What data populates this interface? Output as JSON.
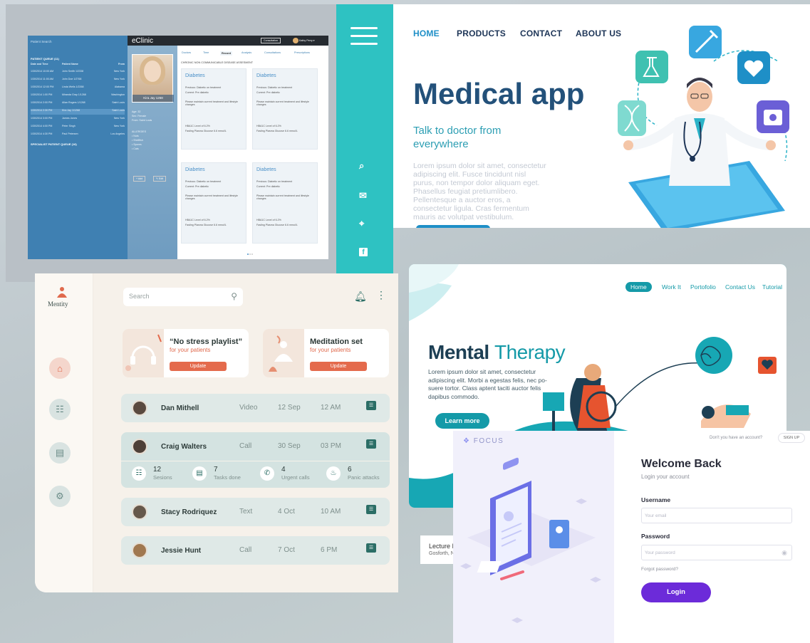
{
  "eclinic": {
    "logo": "eClinic",
    "search": "Patient Search",
    "consultation_btn": "Consultation",
    "user_menu": "Kathy Perry ▾",
    "list_section": "PATIENT QUEUE (11)",
    "list_section2": "SPECIALIST PATIENT QUEUE (16)",
    "list_headers": [
      "Date and Time",
      "Patient Name",
      "From"
    ],
    "rows": [
      [
        "1/30/2014 10:00 AM",
        "John Smith 1/2338",
        "New York"
      ],
      [
        "1/30/2014 11:00 AM",
        "John Doe 1/2768",
        "New York"
      ],
      [
        "1/30/2014 12:00 PM",
        "Linda Wells 1/2268",
        "Alabama"
      ],
      [
        "1/30/2014 1:00 PM",
        "Miranda Gray 1/1268",
        "Washington"
      ],
      [
        "1/30/2014 2:00 PM",
        "Allan Rogers 1/1268",
        "Saint Louis"
      ],
      [
        "1/30/2014 2:30 PM",
        "Kira Jay 1/1268",
        "Saint Louis"
      ],
      [
        "1/30/2014 3:00 PM",
        "James Jones",
        "New York"
      ],
      [
        "1/30/2014 4:00 PM",
        "Peter Singh",
        "New York"
      ],
      [
        "1/30/2014 4:30 PM",
        "Paul Petersen",
        "Los Angeles"
      ]
    ],
    "patient_name": "Kira Jay 1268",
    "patient_info": [
      "Age: 32",
      "Sex: Female",
      "From: Saint Louis"
    ],
    "allergies_title": "ALLERGIES",
    "allergies": [
      "• Nuts",
      "• Shellfish",
      "• Spores",
      "• Cats"
    ],
    "add_btn": "+ Add",
    "edit_btn": "✎ Edit",
    "tabs": [
      "Doctors",
      "Time",
      "Record",
      "Analysis",
      "Consultations",
      "Prescriptions"
    ],
    "active_tab": "Record",
    "assessment_title": "CHRONIC NON COMMUNICABLE DISEASE ASSESMENT",
    "cards": [
      {
        "title": "Diabetes",
        "prev": "Previous: Diabetic on treatment",
        "curr": "Current: Pre diabetic",
        "note": "Please maintain current treatment and lifestyle changes",
        "hba": "HBA1C Level of 6.2%",
        "glu": "Fasting Plasma Glucose 6.6 mmol/L"
      },
      {
        "title": "Diabetes",
        "prev": "Previous: Diabetic on treatment",
        "curr": "Current: Pre diabetic",
        "note": "Please maintain current treatment and lifestyle changes",
        "hba": "HBA1C Level of 6.2%",
        "glu": "Fasting Plasma Glucose 6.6 mmol/L"
      },
      {
        "title": "Diabetes",
        "prev": "Previous: Diabetic on treatment",
        "curr": "Current: Pre diabetic",
        "note": "Please maintain current treatment and lifestyle changes",
        "hba": "HBA1C Level of 6.2%",
        "glu": "Fasting Plasma Glucose 6.6 mmol/L"
      },
      {
        "title": "Diabetes",
        "prev": "Previous: Diabetic on treatment",
        "curr": "Current: Pre diabetic",
        "note": "Please maintain current treatment and lifestyle changes",
        "hba": "HBA1C Level of 6.2%",
        "glu": "Fasting Plasma Glucose 6.6 mmol/L"
      }
    ]
  },
  "sidebar_icons": [
    "search-icon",
    "mail-icon",
    "location-icon",
    "facebook-icon"
  ],
  "sidebar_glyphs": {
    "search": "⌕",
    "mail": "✉",
    "location": "⌖",
    "facebook": "f"
  },
  "medical": {
    "nav": [
      "HOME",
      "PRODUCTS",
      "CONTACT",
      "ABOUT US"
    ],
    "title": "Medical app",
    "subtitle": "Talk to doctor from everywhere",
    "lorem": "Lorem ipsum dolor sit amet, consectetur adipiscing elit. Fusce tincidunt nisl purus, non tempor dolor aliquam eget. Phasellus feugiat pretiumlibero. Pellentesque a auctor eros, a consectetur ligula. Cras fermentum mauris ac volutpat vestibulum."
  },
  "mentity": {
    "brand": "Mentity",
    "search_placeholder": "Search",
    "promos": [
      {
        "title": "“No stress playlist”",
        "sub": "for your patients",
        "btn": "Update"
      },
      {
        "title": "Meditation set",
        "sub": "for your patients",
        "btn": "Update"
      }
    ],
    "patients": [
      {
        "name": "Dan Mithell",
        "type": "Video",
        "date": "12 Sep",
        "time": "12 AM"
      },
      {
        "name": "Craig Walters",
        "type": "Call",
        "date": "30 Sep",
        "time": "03 PM"
      },
      {
        "name": "Stacy Rodriquez",
        "type": "Text",
        "date": "4 Oct",
        "time": "10 AM"
      },
      {
        "name": "Jessie Hunt",
        "type": "Call",
        "date": "7 Oct",
        "time": "6 PM"
      }
    ],
    "stats": [
      {
        "value": "12",
        "label": "Sesions"
      },
      {
        "value": "7",
        "label": "Tasks done"
      },
      {
        "value": "4",
        "label": "Urgent calls"
      },
      {
        "value": "6",
        "label": "Panic attacks"
      }
    ],
    "accent": "#e46a4c"
  },
  "mental": {
    "nav": [
      "Home",
      "Work It",
      "Portofolio",
      "Contact Us",
      "Tutorial"
    ],
    "title_a": "Mental",
    "title_b": "Therapy",
    "lorem": "Lorem ipsum dolor sit amet, consectetur adipiscing elit. Morbi a egestas felis, nec po-suere tortor. Class aptent taciti auctor felis dapibus commodo.",
    "btn": "Learn more"
  },
  "lecture": {
    "title": "Lecture I",
    "sub": "Gosforth, N"
  },
  "focus": {
    "logo": "FOCUS",
    "have_account": "Don't you have an account?",
    "signup": "SIGN UP",
    "title": "Welcome Back",
    "subtitle": "Login your account",
    "username_label": "Username",
    "username_placeholder": "Your email",
    "password_label": "Password",
    "password_placeholder": "Your password",
    "forgot": "Forgot password?",
    "login": "Login"
  }
}
